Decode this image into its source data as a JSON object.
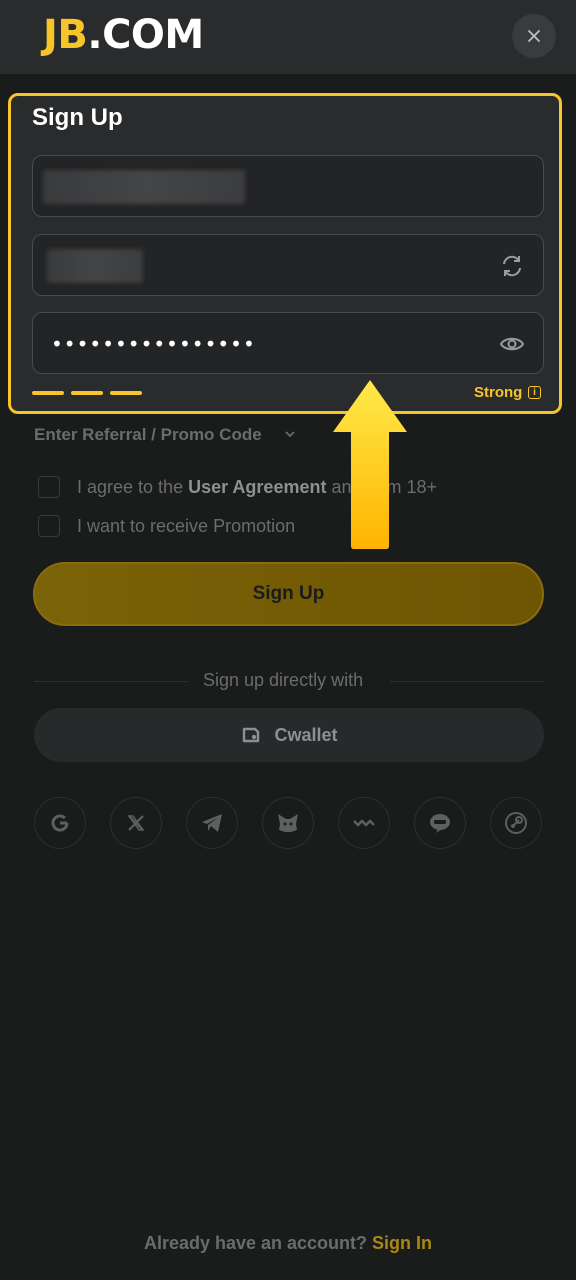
{
  "header": {
    "logo_left": "JB",
    "logo_right": ".COM"
  },
  "form": {
    "title": "Sign Up",
    "password_mask": "••••••••••••••••",
    "strength_label": "Strong",
    "strength_info": "i",
    "referral_label": "Enter Referral / Promo Code",
    "agree_prefix": "I agree to the ",
    "agree_link": "User Agreement",
    "agree_suffix": " and I am 18+",
    "promotion_label": "I want to receive Promotion",
    "submit_label": "Sign Up",
    "divider_text": "Sign up directly with",
    "cwallet_label": "Cwallet"
  },
  "social_icons": [
    "google-icon",
    "x-icon",
    "telegram-icon",
    "metamask-icon",
    "walletconnect-icon",
    "line-icon",
    "steam-icon"
  ],
  "footer": {
    "prompt": "Already have an account? ",
    "link": "Sign In"
  },
  "colors": {
    "accent": "#f7c52a",
    "background": "#1a1b1b",
    "panel": "#2a2b2c"
  }
}
